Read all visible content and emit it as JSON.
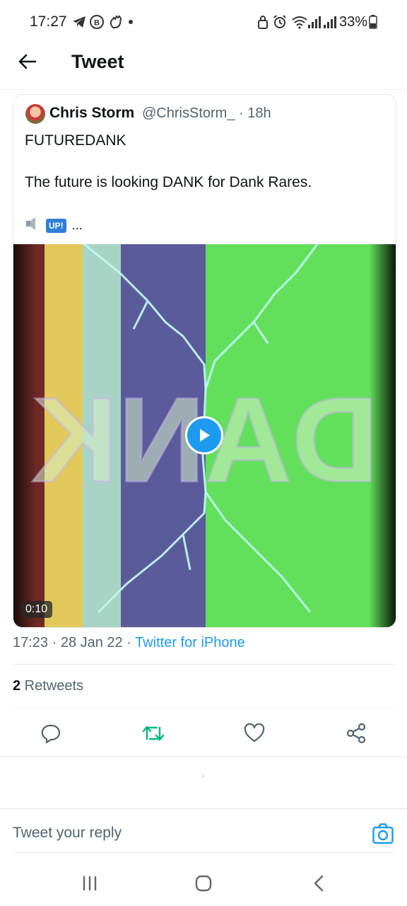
{
  "status_bar": {
    "time": "17:27",
    "battery": "33%"
  },
  "header": {
    "title": "Tweet"
  },
  "quoted_tweet": {
    "author_name": "Chris Storm",
    "author_handle": "@ChrisStorm_ · 18h",
    "line1": "FUTUREDANK",
    "line2": "The future is looking DANK for Dank Rares.",
    "emoji_badge": "UP!",
    "ellipsis": "...",
    "video_text": "DANK",
    "video_duration": "0:10"
  },
  "meta": {
    "time": "17:23 · 28 Jan 22 · ",
    "source": "Twitter for iPhone"
  },
  "stats": {
    "retweet_count": "2",
    "retweet_label": " Retweets"
  },
  "reply": {
    "placeholder": "Tweet your reply"
  },
  "colors": {
    "accent": "#1d9bf0",
    "retweet_green": "#00ba7c",
    "muted_text": "#536471"
  }
}
